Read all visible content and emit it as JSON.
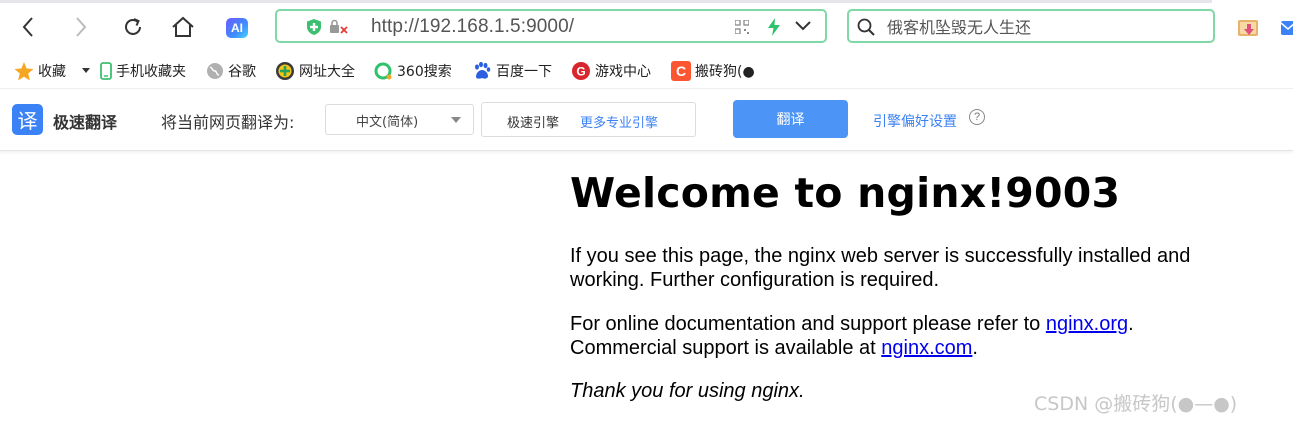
{
  "toolbar": {
    "url": "http://192.168.1.5:9000/",
    "search_placeholder": "俄客机坠毁无人生还",
    "ai_label": "AI"
  },
  "bookmarks": {
    "items": [
      {
        "label": "收藏"
      },
      {
        "label": "手机收藏夹"
      },
      {
        "label": "谷歌"
      },
      {
        "label": "网址大全"
      },
      {
        "label": "360搜索"
      },
      {
        "label": "百度一下"
      },
      {
        "label": "游戏中心"
      },
      {
        "label": "搬砖狗(●"
      }
    ]
  },
  "translate": {
    "logo": "译",
    "name": "极速翻译",
    "prompt": "将当前网页翻译为:",
    "language": "中文(简体)",
    "engine": "极速引擎",
    "more_engines": "更多专业引擎",
    "button": "翻译",
    "preferences": "引擎偏好设置",
    "help": "?"
  },
  "page": {
    "heading": "Welcome to nginx!9003",
    "p1": "If you see this page, the nginx web server is successfully installed and working. Further configuration is required.",
    "p2_text1": "For online documentation and support please refer to ",
    "p2_link1": "nginx.org",
    "p2_text2": ".",
    "p2_text3": "Commercial support is available at ",
    "p2_link2": "nginx.com",
    "p2_text4": ".",
    "p3": "Thank you for using nginx."
  },
  "watermark": "CSDN @搬砖狗(●—●)",
  "colors": {
    "accent_border": "#7fd8a6",
    "translate_button": "#4d94f7",
    "link": "#0000ee"
  }
}
